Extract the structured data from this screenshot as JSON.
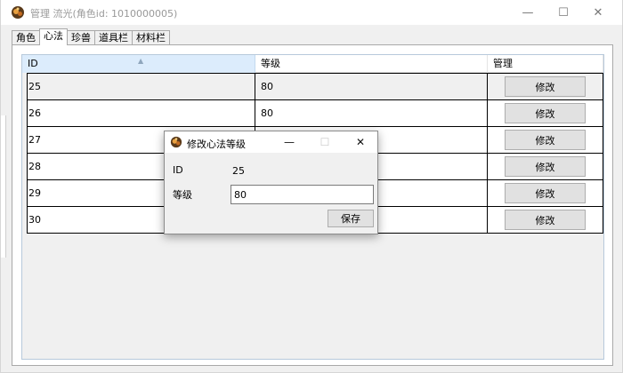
{
  "window": {
    "title": "管理 流光(角色id: 1010000005)",
    "min_glyph": "—",
    "max_glyph": "☐",
    "close_glyph": "✕"
  },
  "tabs": [
    {
      "label": "角色",
      "active": false
    },
    {
      "label": "心法",
      "active": true
    },
    {
      "label": "珍兽",
      "active": false
    },
    {
      "label": "道具栏",
      "active": false
    },
    {
      "label": "材料栏",
      "active": false
    }
  ],
  "grid": {
    "columns": {
      "id": "ID",
      "level": "等级",
      "manage": "管理"
    },
    "sort_glyph": "▲",
    "rows": [
      {
        "id": "25",
        "level": "80",
        "action": "修改"
      },
      {
        "id": "26",
        "level": "80",
        "action": "修改"
      },
      {
        "id": "27",
        "level": "",
        "action": "修改"
      },
      {
        "id": "28",
        "level": "",
        "action": "修改"
      },
      {
        "id": "29",
        "level": "",
        "action": "修改"
      },
      {
        "id": "30",
        "level": "",
        "action": "修改"
      }
    ]
  },
  "dialog": {
    "title": "修改心法等级",
    "min_glyph": "—",
    "max_glyph": "☐",
    "close_glyph": "✕",
    "id_label": "ID",
    "id_value": "25",
    "level_label": "等级",
    "level_value": "80",
    "save_label": "保存"
  },
  "colors": {
    "header_selected": "#dcecfc",
    "button_bg": "#e1e1e1",
    "window_bg": "#f0f0f0"
  }
}
